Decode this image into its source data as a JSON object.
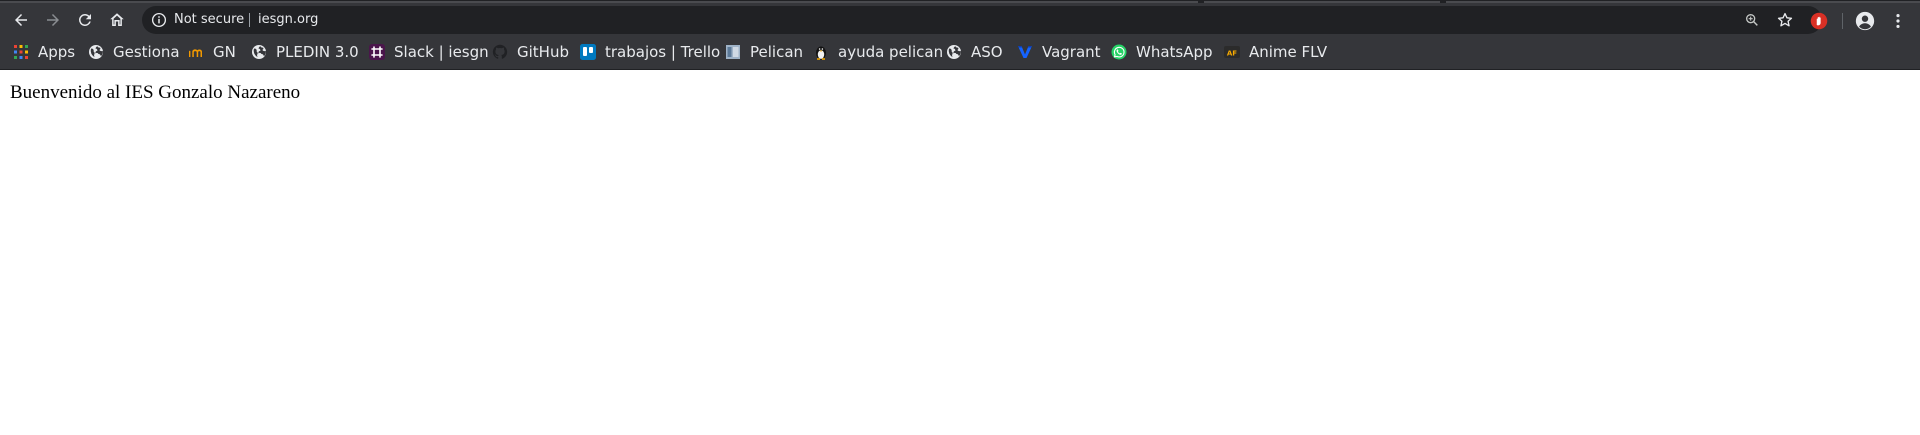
{
  "browser": {
    "security_label": "Not secure",
    "url": "iesgn.org",
    "icons": {
      "back": "back-arrow-icon",
      "forward": "forward-arrow-icon",
      "reload": "reload-icon",
      "home": "home-icon",
      "info": "info-icon",
      "zoom": "zoom-icon",
      "bookmark_star": "star-icon",
      "extension": "extension-hand-icon",
      "profile": "profile-icon",
      "menu": "kebab-menu-icon"
    },
    "colors": {
      "toolbar_bg": "#35363a",
      "omnibox_bg": "#202124",
      "text": "#e8eaed",
      "extension_red": "#d93025"
    }
  },
  "bookmarks": [
    {
      "label": "Apps",
      "icon": "apps-grid-icon"
    },
    {
      "label": "Gestiona",
      "icon": "globe-icon"
    },
    {
      "label": "GN",
      "icon": "gn-logo-icon"
    },
    {
      "label": "PLEDIN 3.0",
      "icon": "globe-icon"
    },
    {
      "label": "Slack | iesgn",
      "icon": "slack-icon"
    },
    {
      "label": "GitHub",
      "icon": "github-icon"
    },
    {
      "label": "trabajos | Trello",
      "icon": "trello-icon"
    },
    {
      "label": "Pelican",
      "icon": "document-icon"
    },
    {
      "label": "ayuda pelican",
      "icon": "penguin-icon"
    },
    {
      "label": "ASO",
      "icon": "globe-icon"
    },
    {
      "label": "Vagrant",
      "icon": "vagrant-icon"
    },
    {
      "label": "WhatsApp",
      "icon": "whatsapp-icon"
    },
    {
      "label": "Anime FLV",
      "icon": "animeflv-icon"
    }
  ],
  "page": {
    "heading": "Buenvenido al IES Gonzalo Nazareno"
  }
}
